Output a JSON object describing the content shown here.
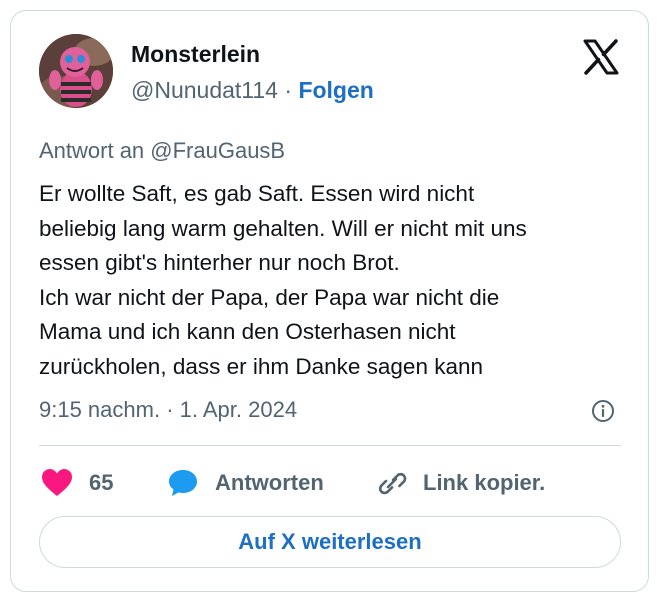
{
  "tweet": {
    "author": {
      "name": "Monsterlein",
      "handle": "@Nunudat114",
      "separator": "·",
      "follow_label": "Folgen"
    },
    "reply_to": "Antwort an @FrauGausB",
    "text_lines": [
      "Er wollte Saft, es gab Saft. Essen wird nicht",
      "beliebig lang warm gehalten. Will er nicht mit uns",
      "essen gibt's hinterher nur noch Brot.",
      "Ich war nicht der Papa, der Papa war nicht die",
      "Mama und ich kann den Osterhasen nicht",
      "zurückholen, dass er ihm Danke sagen kann"
    ],
    "timestamp": "9:15 nachm. · 1. Apr. 2024",
    "actions": {
      "like_count": "65",
      "reply_label": "Antworten",
      "copy_link_label": "Link kopier."
    },
    "read_more_label": "Auf X weiterlesen"
  },
  "icons": {
    "logo": "x-logo-icon",
    "info": "info-icon",
    "like": "heart-icon",
    "reply": "speech-bubble-icon",
    "copy": "link-icon"
  },
  "colors": {
    "heart": "#f91880",
    "reply_bubble": "#1d9bf0",
    "link_accent": "#1d6fc4",
    "secondary_text": "#536471",
    "primary_text": "#0f1419",
    "border": "#cfd9de"
  }
}
